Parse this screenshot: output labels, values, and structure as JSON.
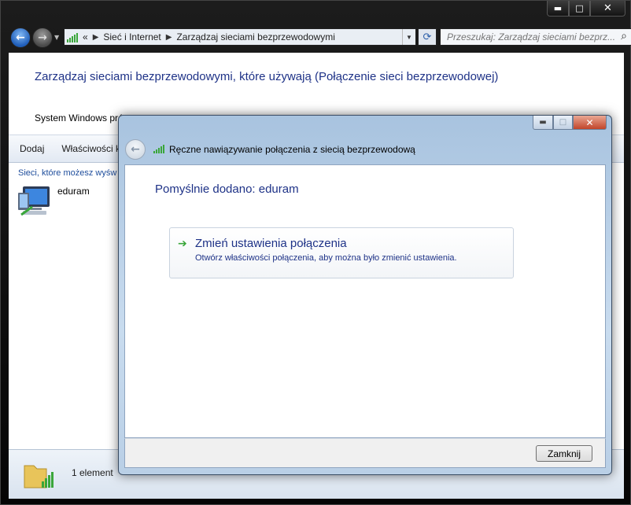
{
  "window": {
    "caption_buttons": {
      "minimize": "▬",
      "maximize": "□",
      "close": "✕"
    },
    "address": {
      "prefix": "«",
      "crumbs": [
        "Sieć i Internet",
        "Zarządzaj sieciami bezprzewodowymi"
      ]
    },
    "search": {
      "placeholder": "Przeszukaj: Zarządzaj sieciami bezprz..."
    }
  },
  "page": {
    "title": "Zarządzaj sieciami bezprzewodowymi, które używają (Połączenie sieci bezprzewodowej)",
    "description": "System Windows pró",
    "toolbar": {
      "add": "Dodaj",
      "properties": "Właściwości ka"
    },
    "networks_label": "Sieci, które możesz wyśw",
    "networks": [
      {
        "name": "eduram"
      }
    ],
    "status_count": "1 element"
  },
  "dialog": {
    "title": "Ręczne nawiązywanie połączenia z siecią bezprzewodową",
    "heading": "Pomyślnie dodano: eduram",
    "command_link": {
      "title": "Zmień ustawienia połączenia",
      "description": "Otwórz właściwości połączenia, aby można było zmienić ustawienia."
    },
    "close_button": "Zamknij"
  },
  "icons": {
    "back": "back-arrow-icon",
    "forward": "forward-arrow-icon",
    "signal": "wireless-signal-icon",
    "network": "wireless-network-computer-icon",
    "status": "folder-signal-icon",
    "command_arrow": "green-arrow-icon"
  },
  "colors": {
    "link_blue": "#1e3287",
    "signal_green": "#3aa63a"
  }
}
